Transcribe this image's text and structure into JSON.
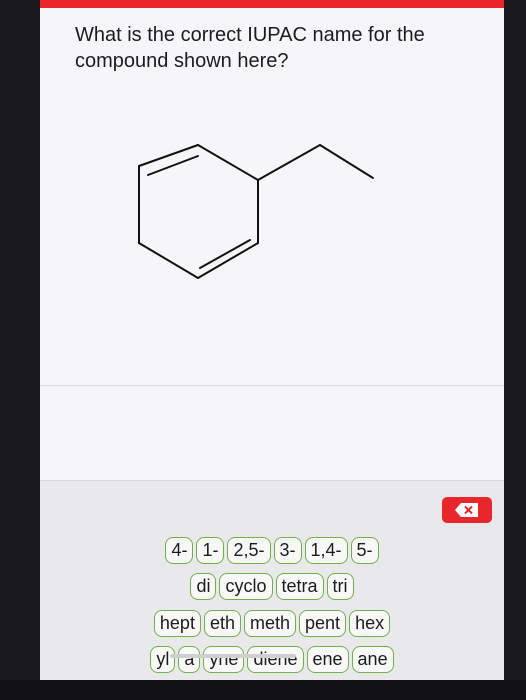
{
  "question": {
    "line1": "What is the correct IUPAC name for the",
    "line2": "compound shown here?"
  },
  "molecule": {
    "description_icon": "ethyl-cyclohexadiene-structure"
  },
  "colors": {
    "accent": "#e8262b",
    "token_border": "#6fb24a",
    "background": "#f3f3f5"
  },
  "delete_button": {
    "icon": "backspace-x-icon"
  },
  "tokens": {
    "row1": [
      "4-",
      "1-",
      "2,5-",
      "3-",
      "1,4-",
      "5-"
    ],
    "row2": [
      "di",
      "cyclo",
      "tetra",
      "tri"
    ],
    "row3": [
      "hept",
      "eth",
      "meth",
      "pent",
      "hex"
    ],
    "row4": [
      "yl",
      "a",
      "yne",
      "diene",
      "ene",
      "ane"
    ]
  }
}
